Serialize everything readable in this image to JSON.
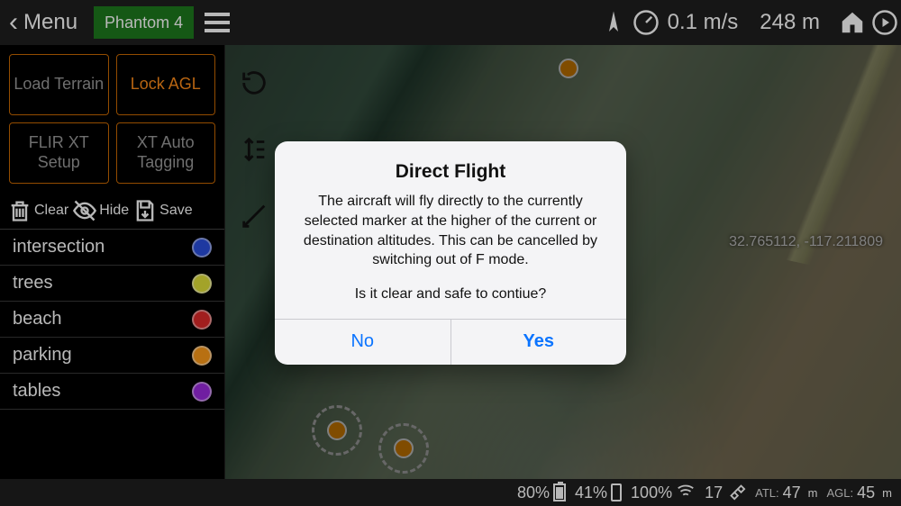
{
  "topbar": {
    "menu_label": "Menu",
    "aircraft": "Phantom 4",
    "speed": "0.1 m/s",
    "distance": "248 m"
  },
  "panel": {
    "buttons": {
      "load_terrain": "Load Terrain",
      "lock_agl": "Lock AGL",
      "flir_setup": "FLIR XT Setup",
      "xt_tag": "XT Auto Tagging"
    },
    "tools": {
      "clear": "Clear",
      "hide": "Hide",
      "save": "Save"
    },
    "items": [
      {
        "label": "intersection",
        "color": "#2a4fe0"
      },
      {
        "label": "trees",
        "color": "#e2e23a"
      },
      {
        "label": "beach",
        "color": "#e02a2a"
      },
      {
        "label": "parking",
        "color": "#ff9b1a"
      },
      {
        "label": "tables",
        "color": "#9b2ae0"
      }
    ]
  },
  "map": {
    "coords": "32.765112, -117.211809"
  },
  "bottom": {
    "batt1_pct": "80%",
    "batt1_fill": "80%",
    "batt2_pct": "41%",
    "batt2_fill": "41%",
    "rc_pct": "100%",
    "sats": "17",
    "atl_label": "ATL:",
    "atl_val": "47",
    "agl_label": "AGL:",
    "agl_val": "45",
    "unit": "m"
  },
  "dialog": {
    "title": "Direct Flight",
    "body": "The aircraft will fly directly to the currently selected marker at the higher of the current or destination altitudes. This can be cancelled by switching out of F mode.",
    "question": "Is it clear and safe to contiue?",
    "no": "No",
    "yes": "Yes"
  }
}
